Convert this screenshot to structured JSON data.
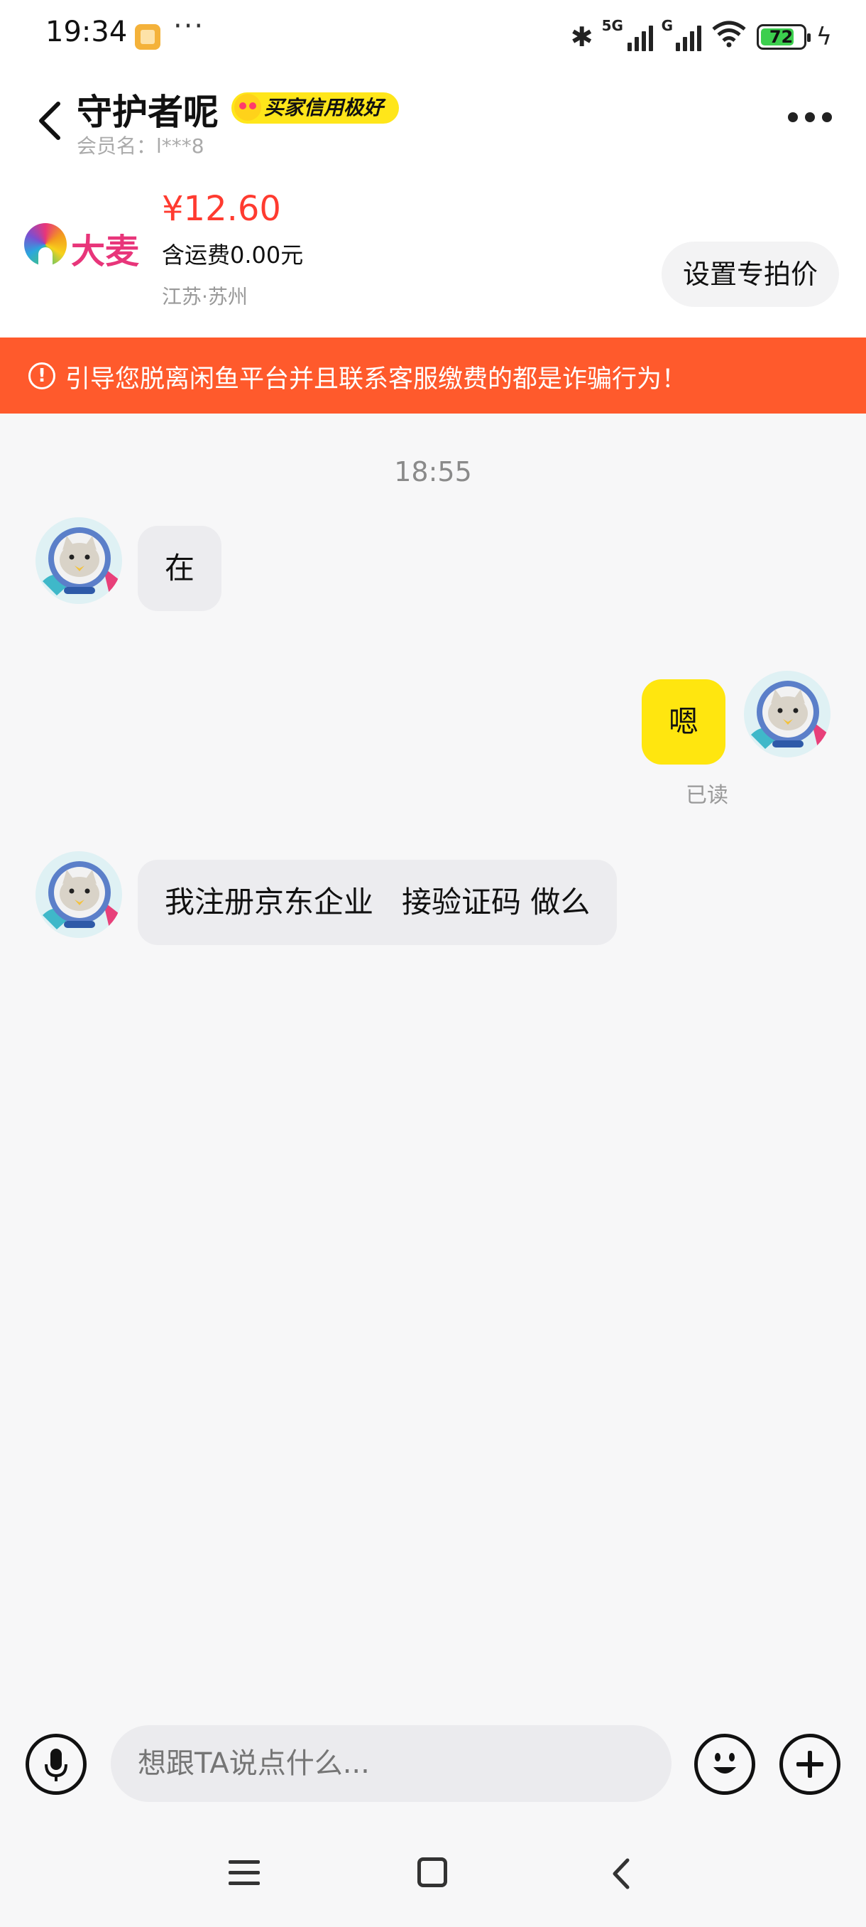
{
  "status_bar": {
    "time": "19:34",
    "dots": "···",
    "battery": "72",
    "network_label_1": "5G",
    "network_label_2": "G"
  },
  "header": {
    "title": "守护者呢",
    "credit_badge": "买家信用极好",
    "member_name": "会员名：l***8"
  },
  "product": {
    "logo_text": "大麦",
    "price": "¥12.60",
    "shipping": "含运费0.00元",
    "location": "江苏·苏州",
    "set_price_button": "设置专拍价"
  },
  "warning": {
    "icon": "!",
    "text": "引导您脱离闲鱼平台并且联系客服缴费的都是诈骗行为！"
  },
  "chat": {
    "timestamp": "18:55",
    "messages": [
      {
        "side": "in",
        "text": "在"
      },
      {
        "side": "out",
        "text": "嗯",
        "status": "已读"
      },
      {
        "side": "in",
        "text": "我注册京东企业   接验证码 做么"
      }
    ]
  },
  "input": {
    "placeholder": "想跟TA说点什么..."
  },
  "colors": {
    "accent_yellow": "#ffe60f",
    "warning_bg": "#ff5a2c",
    "price_red": "#ff3b30"
  }
}
